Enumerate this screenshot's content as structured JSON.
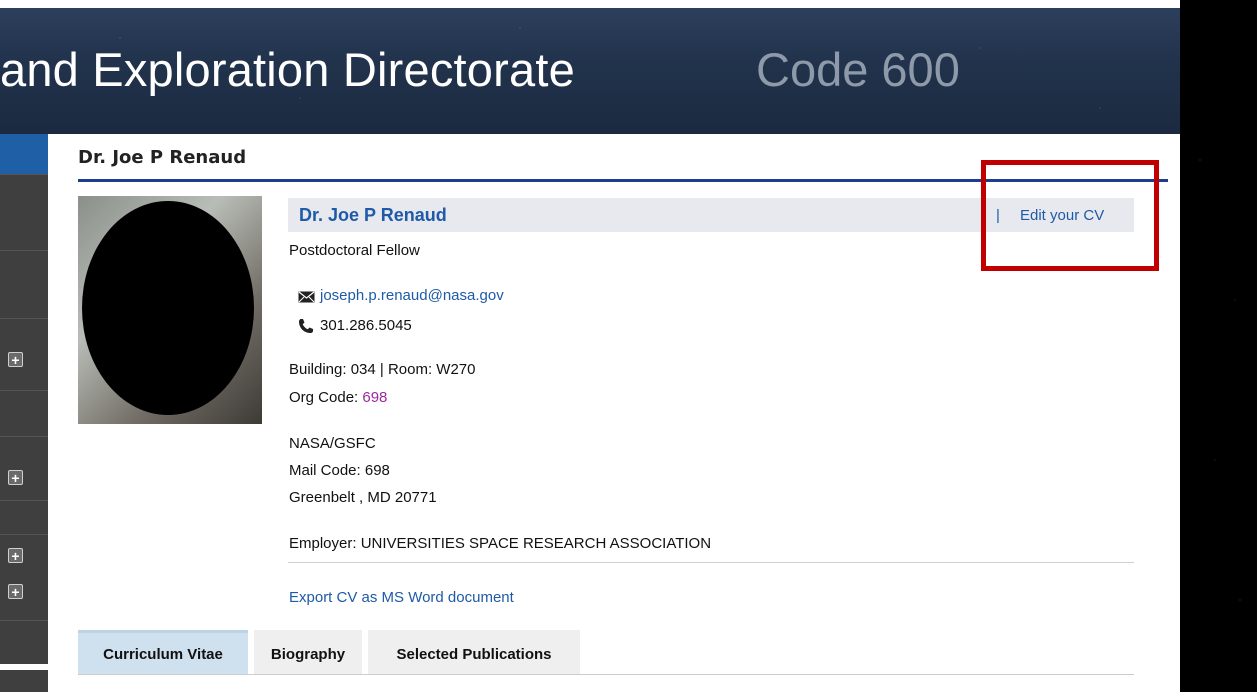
{
  "banner": {
    "title": "and Exploration Directorate",
    "code": "Code 600"
  },
  "page_heading": "Dr. Joe P Renaud",
  "profile": {
    "name": "Dr. Joe P Renaud",
    "separator": "|",
    "edit_link": "Edit your CV",
    "title": "Postdoctoral Fellow",
    "email": "joseph.p.renaud@nasa.gov",
    "phone": "301.286.5045",
    "location": "Building: 034 | Room: W270",
    "org_code_label": "Org Code: ",
    "org_code_value": "698",
    "address_line1": "NASA/GSFC",
    "address_line2": "Mail Code: 698",
    "address_line3": "Greenbelt , MD 20771",
    "employer": "Employer: UNIVERSITIES SPACE RESEARCH ASSOCIATION",
    "export_link": "Export CV as MS Word document"
  },
  "tabs": [
    {
      "label": "Curriculum Vitae",
      "active": true
    },
    {
      "label": "Biography",
      "active": false
    },
    {
      "label": "Selected Publications",
      "active": false
    }
  ],
  "colors": {
    "link": "#1e5aa8",
    "heading_rule": "#1a3f8f",
    "highlight": "#c00000",
    "org_code": "#9c2a9f"
  },
  "icons": {
    "email": "envelope-icon",
    "phone": "phone-icon",
    "sidebar_expand": "plus-box-icon"
  }
}
